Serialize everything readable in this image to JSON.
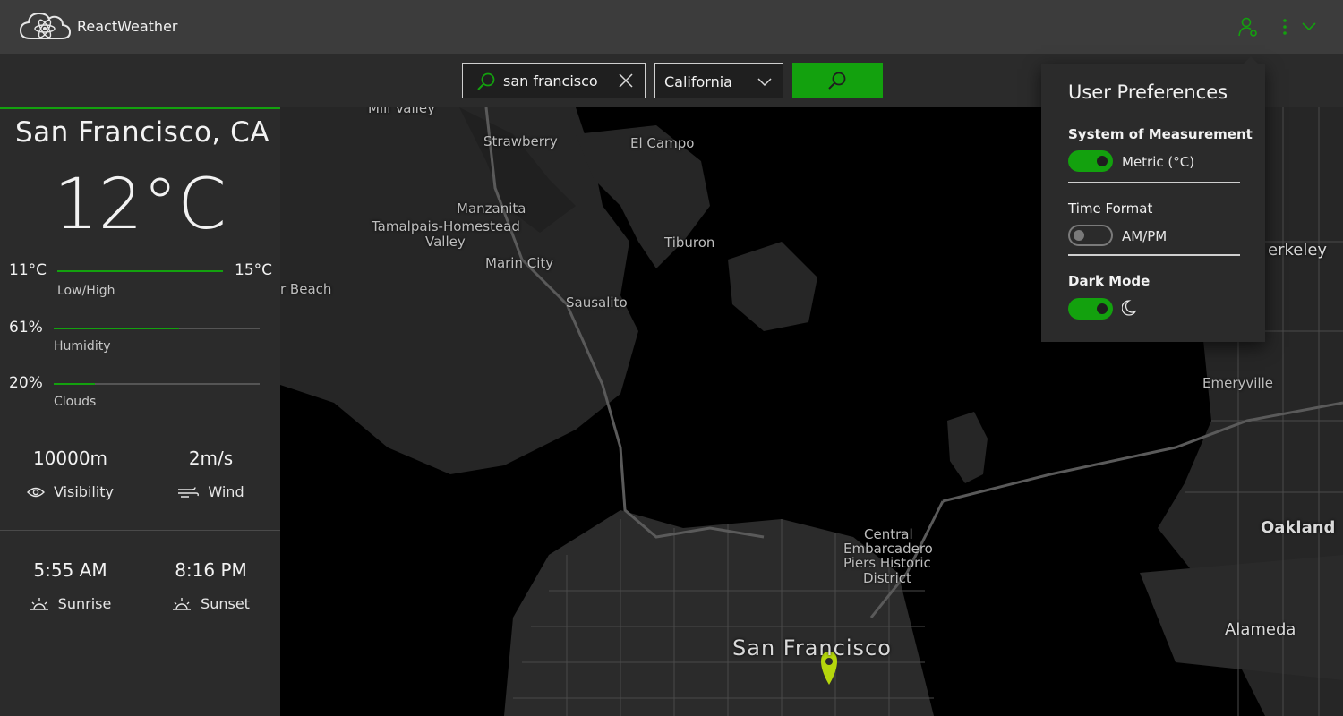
{
  "app": {
    "title": "ReactWeather"
  },
  "search": {
    "query": "san francisco",
    "state": "California"
  },
  "weather": {
    "location": "San Francisco, CA",
    "temperature": "12°C",
    "low": "11°C",
    "high": "15°C",
    "low_high_label": "Low/High",
    "humidity_value": "61%",
    "humidity_label": "Humidity",
    "humidity_fraction": 0.61,
    "clouds_value": "20%",
    "clouds_label": "Clouds",
    "clouds_fraction": 0.2,
    "visibility_value": "10000m",
    "visibility_label": "Visibility",
    "wind_value": "2m/s",
    "wind_label": "Wind",
    "sunrise_value": "5:55 AM",
    "sunrise_label": "Sunrise",
    "sunset_value": "8:16 PM",
    "sunset_label": "Sunset"
  },
  "map": {
    "labels": [
      "Mill Valley",
      "Strawberry",
      "El Campo",
      "Manzanita",
      "Tamalpais-Homestead",
      "Valley",
      "Tiburon",
      "Marin City",
      "Sausalito",
      "r Beach",
      "erkeley",
      "Emeryville",
      "Oakland",
      "Central",
      "Embarcadero",
      "Piers Historic",
      "District",
      "San Francisco",
      "Alameda"
    ]
  },
  "preferences": {
    "title": "User Preferences",
    "measurement_label": "System of Measurement",
    "measurement_value": "Metric (°C)",
    "measurement_on": true,
    "time_label": "Time Format",
    "time_value": "AM/PM",
    "time_on": false,
    "dark_label": "Dark Mode",
    "dark_on": true
  },
  "colors": {
    "accent": "#13a10e",
    "pin": "#b5d60c",
    "titlebar": "#3c3c3c",
    "panel": "#2b2b2b"
  },
  "icons": [
    "react-cloud-logo",
    "user-settings-icon",
    "more-icon",
    "chevron-down-icon",
    "search-icon",
    "close-icon",
    "eye-icon",
    "wind-icon",
    "sunrise-icon",
    "sunset-icon",
    "moon-icon",
    "map-pin-icon"
  ]
}
